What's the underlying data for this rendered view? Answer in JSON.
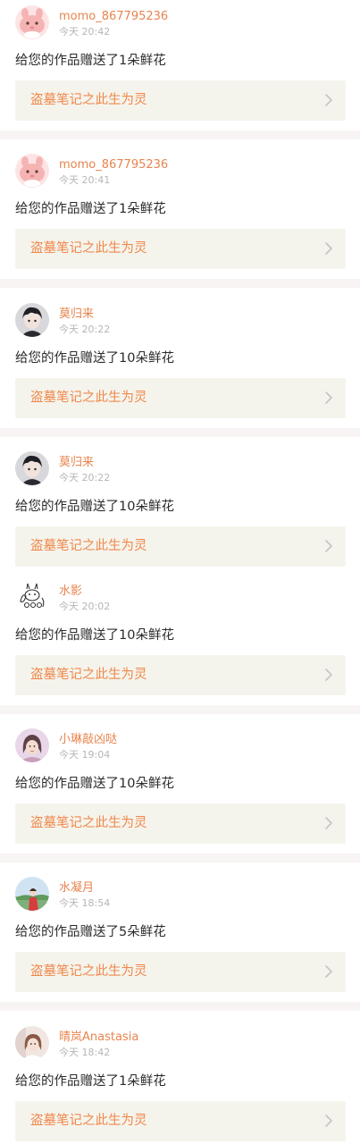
{
  "colors": {
    "username": "#e8844e",
    "time": "#b6b6b6",
    "message": "#2b2b2b",
    "card_background": "#f5f4ec",
    "card_text": "#f0884c",
    "divider": "#f8f4f4"
  },
  "feed": {
    "items": [
      {
        "avatar": "pink-bunny-avatar",
        "username": "momo_867795236",
        "time": "今天 20:42",
        "message": "给您的作品赠送了1朵鲜花",
        "work_title": "盗墓笔记之此生为灵"
      },
      {
        "avatar": "pink-bunny-avatar",
        "username": "momo_867795236",
        "time": "今天 20:41",
        "message": "给您的作品赠送了1朵鲜花",
        "work_title": "盗墓笔记之此生为灵"
      },
      {
        "avatar": "anime-boy-avatar",
        "username": "莫归来",
        "time": "今天 20:22",
        "message": "给您的作品赠送了10朵鲜花",
        "work_title": "盗墓笔记之此生为灵"
      },
      {
        "avatar": "anime-boy-avatar",
        "username": "莫归来",
        "time": "今天 20:22",
        "message": "给您的作品赠送了10朵鲜花",
        "work_title": "盗墓笔记之此生为灵"
      },
      {
        "avatar": "doodle-avatar",
        "username": "水影",
        "time": "今天 20:02",
        "message": "给您的作品赠送了10朵鲜花",
        "work_title": "盗墓笔记之此生为灵"
      },
      {
        "avatar": "girl-photo-avatar",
        "username": "小琳敲凶哒",
        "time": "今天 19:04",
        "message": "给您的作品赠送了10朵鲜花",
        "work_title": "盗墓笔记之此生为灵"
      },
      {
        "avatar": "outdoor-photo-avatar",
        "username": "水凝月",
        "time": "今天 18:54",
        "message": "给您的作品赠送了5朵鲜花",
        "work_title": "盗墓笔记之此生为灵"
      },
      {
        "avatar": "portrait-photo-avatar",
        "username": "晴岚Anastasia",
        "time": "今天 18:42",
        "message": "给您的作品赠送了1朵鲜花",
        "work_title": "盗墓笔记之此生为灵"
      }
    ]
  }
}
